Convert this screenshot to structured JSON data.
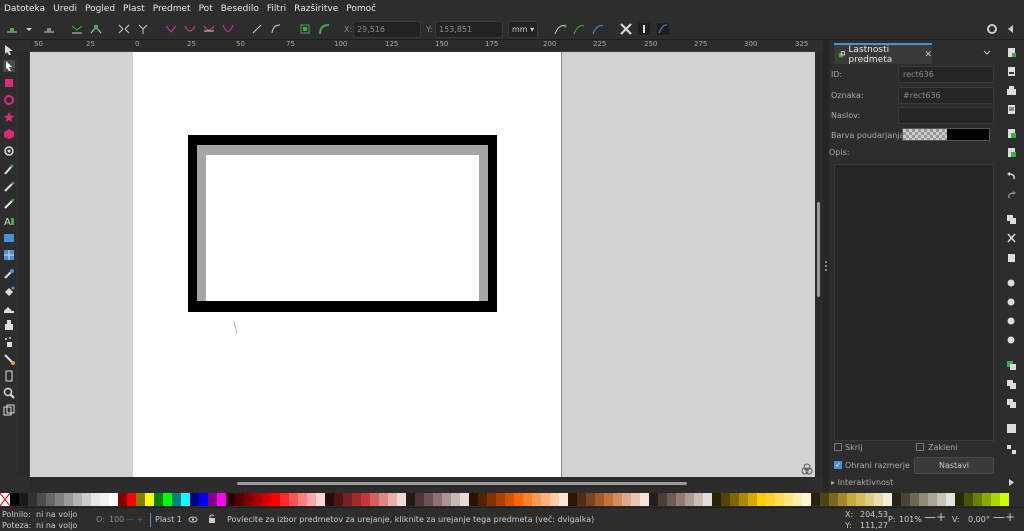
{
  "menu": [
    "Datoteka",
    "Uredi",
    "Pogled",
    "Plast",
    "Predmet",
    "Pot",
    "Besedilo",
    "Filtri",
    "Razširitve",
    "Pomoč"
  ],
  "toolcontrols": {
    "x_label": "X:",
    "x_value": "29,516",
    "y_label": "Y:",
    "y_value": "153,851",
    "unit": "mm"
  },
  "ruler_top": [
    "50",
    "25",
    "0",
    "25",
    "50",
    "75",
    "100",
    "125",
    "150",
    "175",
    "200",
    "225",
    "250",
    "275",
    "300",
    "325"
  ],
  "panel": {
    "tab_title": "Lastnosti predmeta",
    "id_label": "ID:",
    "id_value": "rect636",
    "label_label": "Oznaka:",
    "label_value": "#rect636",
    "title_label": "Naslov:",
    "title_value": "",
    "highlight_label": "Barva poudarjanja:",
    "desc_label": "Opis:",
    "hide_label": "Skrij",
    "lock_label": "Zakleni",
    "preserve_label": "Ohrani razmerje",
    "set_button": "Nastavi",
    "interactivity": "Interaktivnost"
  },
  "status": {
    "fill_label": "Polnilo:",
    "fill_value": "ni na voljo",
    "stroke_label": "Poteza:",
    "stroke_value": "ni na voljo",
    "opacity_label": "O:",
    "opacity_value": "100",
    "layer": "Plast 1",
    "message": "Povlecite za izbor predmetov za urejanje, kliknite za urejanje tega predmeta (več: dvigalka)",
    "x_label": "X:",
    "x_value": "204,53",
    "y_label": "Y:",
    "y_value": "111,27",
    "zoom_label": "P:",
    "zoom_value": "101%",
    "rot_label": "V:",
    "rot_value": "0,00°"
  },
  "colors": {
    "accent": "#4a90d9",
    "panel_bg": "#2d2d2d",
    "canvas_bg": "#d2d2d2"
  },
  "palette_swatches": [
    "#000000",
    "#1a1a1a",
    "#333333",
    "#4d4d4d",
    "#666666",
    "#808080",
    "#999999",
    "#b3b3b3",
    "#cccccc",
    "#e6e6e6",
    "#f2f2f2",
    "#ffffff",
    "#800000",
    "#ff0000",
    "#808000",
    "#ffff00",
    "#008000",
    "#00ff00",
    "#008080",
    "#00ffff",
    "#000080",
    "#0000ff",
    "#800080",
    "#ff00ff",
    "#2b0000",
    "#550000",
    "#800000",
    "#aa0000",
    "#d40000",
    "#ff0000",
    "#ff2a2a",
    "#ff5555",
    "#ff8080",
    "#ffaaaa",
    "#ffd5d5",
    "#280b0b",
    "#501616",
    "#782121",
    "#a02c2c",
    "#c83737",
    "#d35f5f",
    "#de8787",
    "#e9afaf",
    "#f4d7d7",
    "#241c1c",
    "#483737",
    "#6c5353",
    "#916f6f",
    "#ac9393",
    "#c8b7b7",
    "#e3dbdb",
    "#2b1100",
    "#552200",
    "#803300",
    "#aa4400",
    "#d45500",
    "#ff6600",
    "#ff7f2a",
    "#ff9955",
    "#ffb380",
    "#ffccaa",
    "#ffe6d5",
    "#28170b",
    "#502d16",
    "#784421",
    "#a05a2c",
    "#c87137",
    "#d38d5f",
    "#deaa87",
    "#e9c6af",
    "#f4e3d7",
    "#241f1c",
    "#483e37",
    "#6c5d53",
    "#917c6f",
    "#ac9d93",
    "#c8beb7",
    "#e3dedb",
    "#2b2200",
    "#554400",
    "#806600",
    "#aa8800",
    "#d4aa00",
    "#ffcc00",
    "#ffd42a",
    "#ffdd55",
    "#ffe680",
    "#ffeeaa",
    "#fff6d5",
    "#28220b",
    "#504416",
    "#786721",
    "#a0892c",
    "#c8ab37",
    "#d3bc5f",
    "#decd87",
    "#e9ddaf",
    "#f4eed7",
    "#24221c",
    "#484537",
    "#6c6753",
    "#918a6f",
    "#aca793",
    "#c8c4b7",
    "#e3e2db",
    "#222b00",
    "#445500",
    "#668000",
    "#88aa00",
    "#aad400",
    "#ccff00"
  ]
}
